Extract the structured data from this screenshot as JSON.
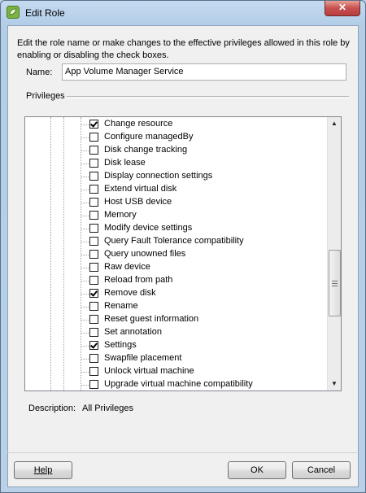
{
  "window": {
    "title": "Edit Role",
    "close_glyph": "✕"
  },
  "dialog": {
    "instructions": "Edit the role name or make changes to the effective privileges allowed in this role by enabling or disabling the check boxes.",
    "name_label": "Name:",
    "name_value": "App Volume Manager Service",
    "privileges_label": "Privileges",
    "description_label": "Description:",
    "description_value": "All Privileges"
  },
  "privileges": [
    {
      "label": "Change resource",
      "checked": true
    },
    {
      "label": "Configure managedBy",
      "checked": false
    },
    {
      "label": "Disk change tracking",
      "checked": false
    },
    {
      "label": "Disk lease",
      "checked": false
    },
    {
      "label": "Display connection settings",
      "checked": false
    },
    {
      "label": "Extend virtual disk",
      "checked": false
    },
    {
      "label": "Host USB device",
      "checked": false
    },
    {
      "label": "Memory",
      "checked": false
    },
    {
      "label": "Modify device settings",
      "checked": false
    },
    {
      "label": "Query Fault Tolerance compatibility",
      "checked": false
    },
    {
      "label": "Query unowned files",
      "checked": false
    },
    {
      "label": "Raw device",
      "checked": false
    },
    {
      "label": "Reload from path",
      "checked": false
    },
    {
      "label": "Remove disk",
      "checked": true
    },
    {
      "label": "Rename",
      "checked": false
    },
    {
      "label": "Reset guest information",
      "checked": false
    },
    {
      "label": "Set annotation",
      "checked": false
    },
    {
      "label": "Settings",
      "checked": true
    },
    {
      "label": "Swapfile placement",
      "checked": false
    },
    {
      "label": "Unlock virtual machine",
      "checked": false
    },
    {
      "label": "Upgrade virtual machine compatibility",
      "checked": false
    }
  ],
  "scrollbar": {
    "up_glyph": "▲",
    "down_glyph": "▼",
    "position": 0.5
  },
  "buttons": {
    "help": "Help",
    "ok": "OK",
    "cancel": "Cancel"
  },
  "icons": {
    "app": "vsphere-logo-icon",
    "close": "close-icon"
  },
  "colors": {
    "title_bar": "#bcd3ea",
    "close_button": "#c75050",
    "client_bg": "#f0f0f0"
  }
}
